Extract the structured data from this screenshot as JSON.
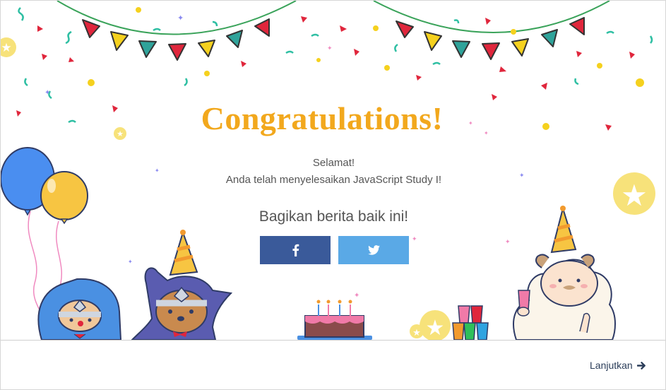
{
  "dialog": {
    "title": "Congratulations!",
    "message_line1": "Selamat!",
    "message_line2": "Anda telah menyelesaikan JavaScript Study I!",
    "share_heading": "Bagikan berita baik ini!",
    "share_buttons": [
      {
        "network": "facebook",
        "icon": "facebook-icon",
        "color": "#3a5a9a"
      },
      {
        "network": "twitter",
        "icon": "twitter-icon",
        "color": "#5aa9e6"
      }
    ],
    "continue_label": "Lanjutkan",
    "continue_icon": "arrow-right-icon"
  },
  "colors": {
    "title": "#f2a81d",
    "text": "#555555",
    "link": "#2c3e5a",
    "pennant_red": "#e0263c",
    "pennant_yellow": "#f5d11e",
    "pennant_teal": "#2fa39a",
    "balloon_blue": "#4a8ef0",
    "balloon_yellow": "#f7c542"
  }
}
